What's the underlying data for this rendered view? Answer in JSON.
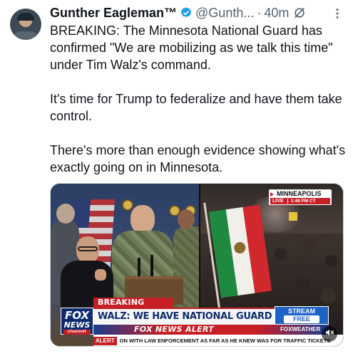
{
  "tweet": {
    "display_name": "Gunther Eagleman™",
    "handle": "@Gunth...",
    "separator": "·",
    "time": "40m",
    "paragraphs": [
      "BREAKING: The Minnesota National Guard has confirmed \"We are mobilizing as we talk this time\" under Tim Walz's command.",
      "It's time for Trump to federalize and have them take control.",
      "There's more than enough evidence showing what's exactly going on in Minnesota."
    ]
  },
  "media": {
    "location": "MINNEAPOLIS",
    "live": "LIVE",
    "clock": "1:48 PM CT",
    "breaking_label": "BREAKING NEWS",
    "headline": "WALZ: WE HAVE NATIONAL GUARD TROOPS STAGED",
    "stream_line1": "STREAM",
    "stream_line2": "FREE",
    "alert_bar": "FOX NEWS ALERT",
    "weather": "FOXWEATHER",
    "logo_fox": "FOX",
    "logo_news": "NEWS",
    "logo_channel": "channel",
    "ticker_label": "ALERT",
    "ticker_text": "ON WITH LAW ENFORCEMENT AS FAR AS HE KNEW WAS FOR TRAFFIC TICKETS"
  },
  "colors": {
    "verified": "#1d9bf0",
    "text": "#0f1419",
    "secondary": "#536471",
    "fox_red": "#c61f26",
    "fox_blue": "#0d2b6e"
  },
  "icons": [
    "verified-badge-icon",
    "grok-icon",
    "more-options-icon",
    "mute-icon"
  ]
}
